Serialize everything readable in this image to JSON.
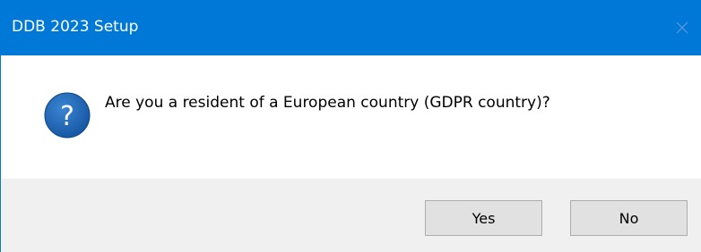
{
  "window": {
    "title": "DDB 2023 Setup"
  },
  "dialog": {
    "icon": "question-icon",
    "message": "Are you a resident of a European country (GDPR country)?"
  },
  "buttons": {
    "yes_label": "Yes",
    "no_label": "No"
  },
  "colors": {
    "titlebar": "#0078d7",
    "footer": "#f0f0f0",
    "button_face": "#e1e1e1",
    "icon_blue": "#1c5fa6"
  }
}
